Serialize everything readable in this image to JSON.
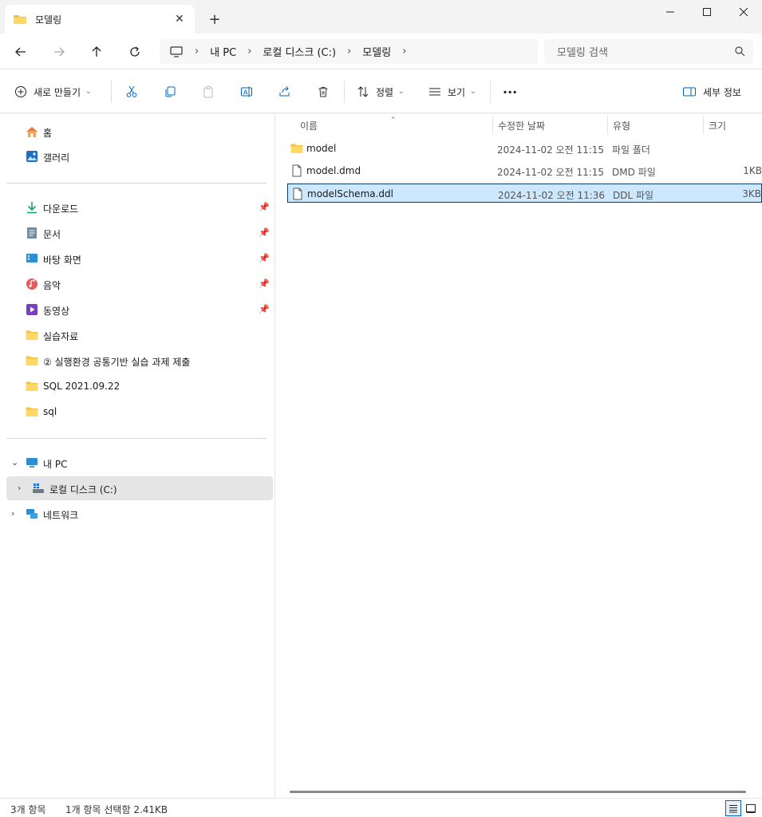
{
  "window": {
    "tab_title": "모델링",
    "tab_icon": "folder-icon",
    "close_tab_glyph": "✕",
    "new_tab_glyph": "+",
    "minimize_glyph": "—",
    "maximize_glyph": "☐",
    "close_glyph": "✕"
  },
  "address": {
    "breadcrumbs": [
      "내 PC",
      "로컬 디스크 (C:)",
      "모델링"
    ],
    "search_placeholder": "모델링 검색"
  },
  "toolbar": {
    "new_label": "새로 만들기",
    "sort_label": "정렬",
    "view_label": "보기",
    "more_glyph": "···",
    "details_label": "세부 정보"
  },
  "sidebar": {
    "quick": [
      {
        "label": "홈",
        "icon": "home-icon"
      },
      {
        "label": "갤러리",
        "icon": "gallery-icon"
      }
    ],
    "pinned": [
      {
        "label": "다운로드",
        "icon": "download-icon",
        "pinned": true
      },
      {
        "label": "문서",
        "icon": "document-icon",
        "pinned": true
      },
      {
        "label": "바탕 화면",
        "icon": "desktop-icon",
        "pinned": true
      },
      {
        "label": "음악",
        "icon": "music-icon",
        "pinned": true
      },
      {
        "label": "동영상",
        "icon": "video-icon",
        "pinned": true
      },
      {
        "label": "실습자료",
        "icon": "folder-icon",
        "pinned": false
      },
      {
        "label": "② 실행환경 공통기반 실습 과제 제출",
        "icon": "folder-icon",
        "pinned": false
      },
      {
        "label": "SQL 2021.09.22",
        "icon": "folder-icon",
        "pinned": false
      },
      {
        "label": "sql",
        "icon": "folder-icon",
        "pinned": false
      }
    ],
    "tree": [
      {
        "label": "내 PC",
        "icon": "pc-icon",
        "chevron": "⌄"
      },
      {
        "label": "로컬 디스크 (C:)",
        "icon": "drive-icon",
        "chevron": "›"
      },
      {
        "label": "네트워크",
        "icon": "network-icon",
        "chevron": "›"
      }
    ]
  },
  "columns": {
    "name": "이름",
    "date": "수정한 날짜",
    "type": "유형",
    "size": "크기"
  },
  "files": [
    {
      "name": "model",
      "date": "2024-11-02 오전 11:15",
      "type": "파일 폴더",
      "size": "",
      "icon": "folder-icon"
    },
    {
      "name": "model.dmd",
      "date": "2024-11-02 오전 11:15",
      "type": "DMD 파일",
      "size": "1KB",
      "icon": "file-icon"
    },
    {
      "name": "modelSchema.ddl",
      "date": "2024-11-02 오전 11:36",
      "type": "DDL 파일",
      "size": "3KB",
      "icon": "file-icon"
    }
  ],
  "status": {
    "item_count": "3개 항목",
    "selection": "1개 항목 선택함 2.41KB"
  },
  "colors": {
    "accent": "#0067c0",
    "selection_bg": "#cce8ff",
    "folder": "#f5c242"
  }
}
